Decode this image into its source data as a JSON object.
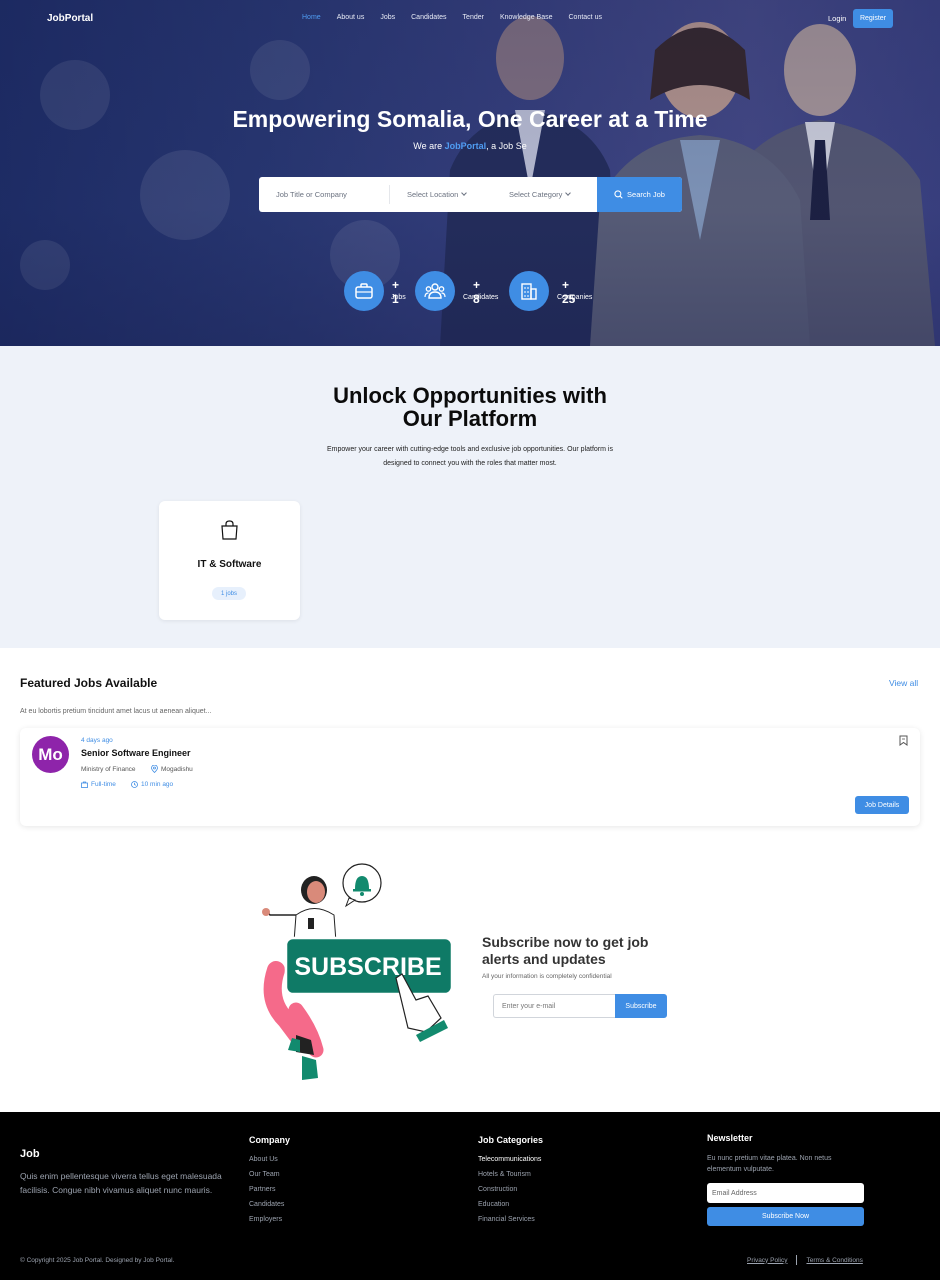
{
  "nav": {
    "logo": "JobPortal",
    "links": [
      "Home",
      "About us",
      "Jobs",
      "Candidates",
      "Tender",
      "Knowledge Base",
      "Contact us"
    ],
    "active": "Home",
    "login": "Login",
    "register": "Register"
  },
  "hero": {
    "title": "Empowering Somalia, One Career at a Time",
    "subtitle_prefix": "We are ",
    "subtitle_brand": "JobPortal",
    "subtitle_suffix": ", a Job Se",
    "search": {
      "title_placeholder": "Job Title or Company",
      "location": "Select Location",
      "category": "Select Category",
      "button": "Search Job"
    },
    "stats": [
      {
        "num": "+ 1",
        "label": "Jobs",
        "icon": "briefcase-icon"
      },
      {
        "num": "+ 8",
        "label": "Candidates",
        "icon": "users-icon"
      },
      {
        "num": "+ 25",
        "label": "Companies",
        "icon": "building-icon"
      }
    ]
  },
  "opportunities": {
    "title_line1": "Unlock Opportunities with",
    "title_line2": "Our Platform",
    "desc_line1": "Empower your career with cutting-edge tools and exclusive job opportunities. Our platform is",
    "desc_line2": "designed to connect you with the roles that matter most.",
    "categories": [
      {
        "name": "IT & Software",
        "count": "1 jobs",
        "icon": "shopping-bag-icon"
      }
    ]
  },
  "featured": {
    "title": "Featured Jobs Available",
    "view_all": "View all",
    "desc": "At eu lobortis pretium tincidunt amet lacus ut aenean aliquet...",
    "jobs": [
      {
        "avatar": "Mo",
        "age": "4 days ago",
        "title": "Senior Software Engineer",
        "company": "Ministry of Finance",
        "location": "Mogadishu",
        "type": "Full-time",
        "posted": "10 min ago",
        "button": "Job Details"
      }
    ]
  },
  "subscribe": {
    "title": "Subscribe now to get job alerts and updates",
    "note": "All your information is completely confidential",
    "placeholder": "Enter your e-mail",
    "button": "Subscribe",
    "illustration_text": "SUBSCRIBE"
  },
  "footer": {
    "brand": "Job",
    "about": "Quis enim pellentesque viverra tellus eget malesuada facilisis. Congue nibh vivamus aliquet nunc mauris.",
    "company_title": "Company",
    "company_links": [
      "About Us",
      "Our Team",
      "Partners",
      "Candidates",
      "Employers"
    ],
    "categories_title": "Job Categories",
    "category_links": [
      "Telecommunications",
      "Hotels & Tourism",
      "Construction",
      "Education",
      "Financial Services"
    ],
    "newsletter_title": "Newsletter",
    "newsletter_desc": "Eu nunc pretium vitae platea. Non netus elementum vulputate.",
    "newsletter_placeholder": "Email Address",
    "newsletter_button": "Subscribe Now",
    "copyright": "© Copyright 2025 Job Portal. Designed by Job Portal.",
    "privacy": "Privacy Policy",
    "terms": "Terms & Conditions"
  },
  "colors": {
    "accent": "#3f8de4",
    "hero_bg": "#2b3b78",
    "section_bg": "#eef2f9",
    "footer_bg": "#000000",
    "avatar_bg": "#8e24aa"
  }
}
